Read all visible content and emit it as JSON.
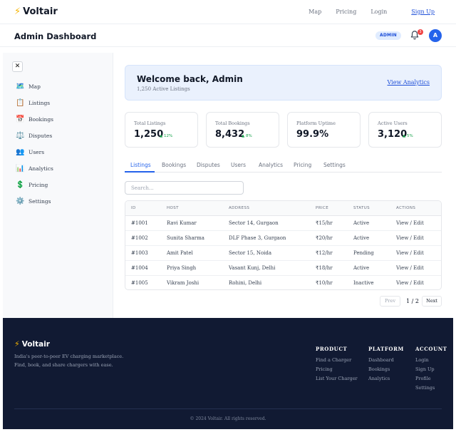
{
  "brand": {
    "name": "Voltair",
    "icon": "lightning-bolt-icon"
  },
  "topnav": {
    "links": [
      "Map",
      "Pricing",
      "Login"
    ],
    "signup": "Sign Up"
  },
  "header": {
    "title": "Admin Dashboard",
    "role_badge": "ADMIN",
    "notification_count": "3",
    "avatar_initial": "A"
  },
  "sidebar": {
    "close_icon": "close-icon",
    "items": [
      {
        "label": "Map",
        "icon": "map-icon"
      },
      {
        "label": "Listings",
        "icon": "clipboard-icon"
      },
      {
        "label": "Bookings",
        "icon": "calendar-icon"
      },
      {
        "label": "Disputes",
        "icon": "scales-icon"
      },
      {
        "label": "Users",
        "icon": "users-icon"
      },
      {
        "label": "Analytics",
        "icon": "bar-chart-icon"
      },
      {
        "label": "Pricing",
        "icon": "dollar-icon"
      },
      {
        "label": "Settings",
        "icon": "gear-icon"
      }
    ]
  },
  "welcome": {
    "title": "Welcome back, Admin",
    "subtitle": "1,250 Active Listings",
    "link": "View Analytics"
  },
  "stats": [
    {
      "label": "Total Listings",
      "value": "1,250",
      "change": "▲ 12%"
    },
    {
      "label": "Total Bookings",
      "value": "8,432",
      "change": "▲ 8%"
    },
    {
      "label": "Platform Uptime",
      "value": "99.9%",
      "change": ""
    },
    {
      "label": "Active Users",
      "value": "3,120",
      "change": "▲ 5%"
    }
  ],
  "tabs": [
    "Listings",
    "Bookings",
    "Disputes",
    "Users",
    "Analytics",
    "Pricing",
    "Settings"
  ],
  "active_tab": "Listings",
  "search": {
    "placeholder": "Search...",
    "value": ""
  },
  "table": {
    "columns": [
      "ID",
      "HOST",
      "ADDRESS",
      "PRICE",
      "STATUS",
      "ACTIONS"
    ],
    "rows": [
      [
        "#1001",
        "Ravi Kumar",
        "Sector 14, Gurgaon",
        "₹15/hr",
        "Active",
        "View / Edit"
      ],
      [
        "#1002",
        "Sunita Sharma",
        "DLF Phase 3, Gurgaon",
        "₹20/hr",
        "Active",
        "View / Edit"
      ],
      [
        "#1003",
        "Amit Patel",
        "Sector 15, Noida",
        "₹12/hr",
        "Pending",
        "View / Edit"
      ],
      [
        "#1004",
        "Priya Singh",
        "Vasant Kunj, Delhi",
        "₹18/hr",
        "Active",
        "View / Edit"
      ],
      [
        "#1005",
        "Vikram Joshi",
        "Rohini, Delhi",
        "₹10/hr",
        "Inactive",
        "View / Edit"
      ]
    ]
  },
  "pagination": {
    "prev": "Prev",
    "info": "1 / 2",
    "next": "Next"
  },
  "footer": {
    "tagline_1": "India's peer-to-peer EV charging marketplace.",
    "tagline_2": "Find, book, and share chargers with ease.",
    "columns": [
      {
        "heading": "PRODUCT",
        "links": [
          "Find a Charger",
          "Pricing",
          "List Your Charger"
        ]
      },
      {
        "heading": "PLATFORM",
        "links": [
          "Dashboard",
          "Bookings",
          "Analytics"
        ]
      },
      {
        "heading": "ACCOUNT",
        "links": [
          "Login",
          "Sign Up",
          "Profile",
          "Settings"
        ]
      }
    ],
    "copyright": "© 2024 Voltair. All rights reserved."
  },
  "colors": {
    "accent": "#2563eb",
    "brand_bolt": "#f5b400",
    "footer_bg": "#111a33",
    "positive": "#16a34a",
    "alert": "#ef4444"
  }
}
